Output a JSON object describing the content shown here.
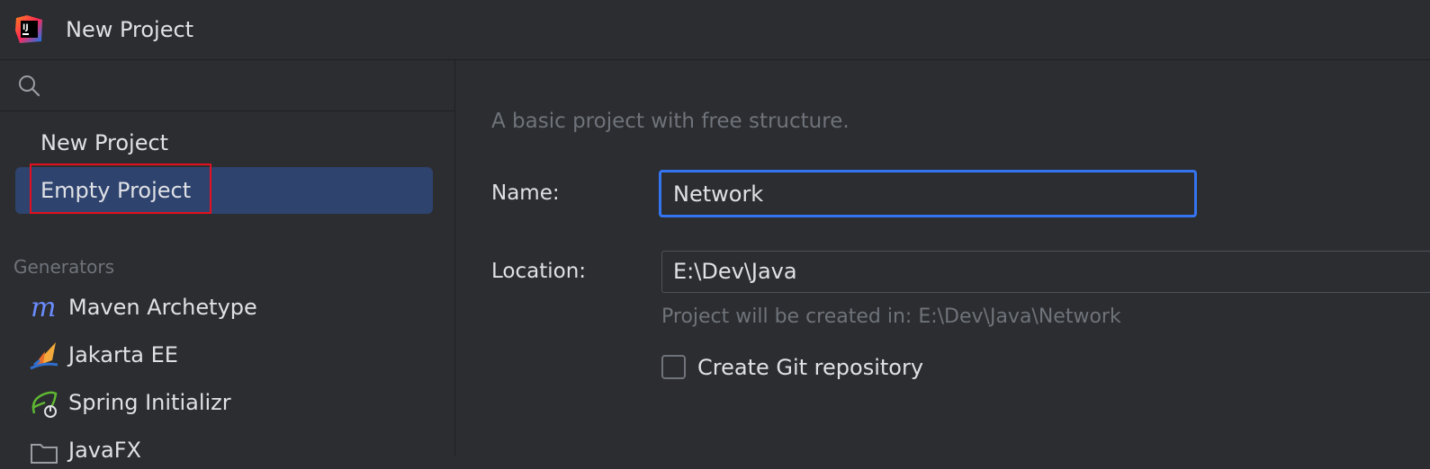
{
  "window": {
    "title": "New Project",
    "logo": "intellij-idea-logo"
  },
  "sidebar": {
    "search": {
      "placeholder": "",
      "icon": "search-icon"
    },
    "project_types": [
      {
        "label": "New Project"
      },
      {
        "label": "Empty Project",
        "selected": true,
        "highlighted": true
      }
    ],
    "generators_header": "Generators",
    "generators": [
      {
        "label": "Maven Archetype",
        "icon": "maven-icon"
      },
      {
        "label": "Jakarta EE",
        "icon": "jakarta-ee-icon"
      },
      {
        "label": "Spring Initializr",
        "icon": "spring-icon"
      },
      {
        "label": "JavaFX",
        "icon": "folder-icon"
      }
    ]
  },
  "form": {
    "description": "A basic project with free structure.",
    "name_label": "Name:",
    "name_value": "Network",
    "location_label": "Location:",
    "location_value": "E:\\Dev\\Java",
    "location_hint": "Project will be created in: E:\\Dev\\Java\\Network",
    "git_label": "Create Git repository",
    "git_checked": false
  },
  "colors": {
    "background": "#2b2d30",
    "selection": "#2e436e",
    "focus_border": "#3574f0",
    "highlight_box": "#e3101f",
    "muted_text": "#6f737a"
  }
}
